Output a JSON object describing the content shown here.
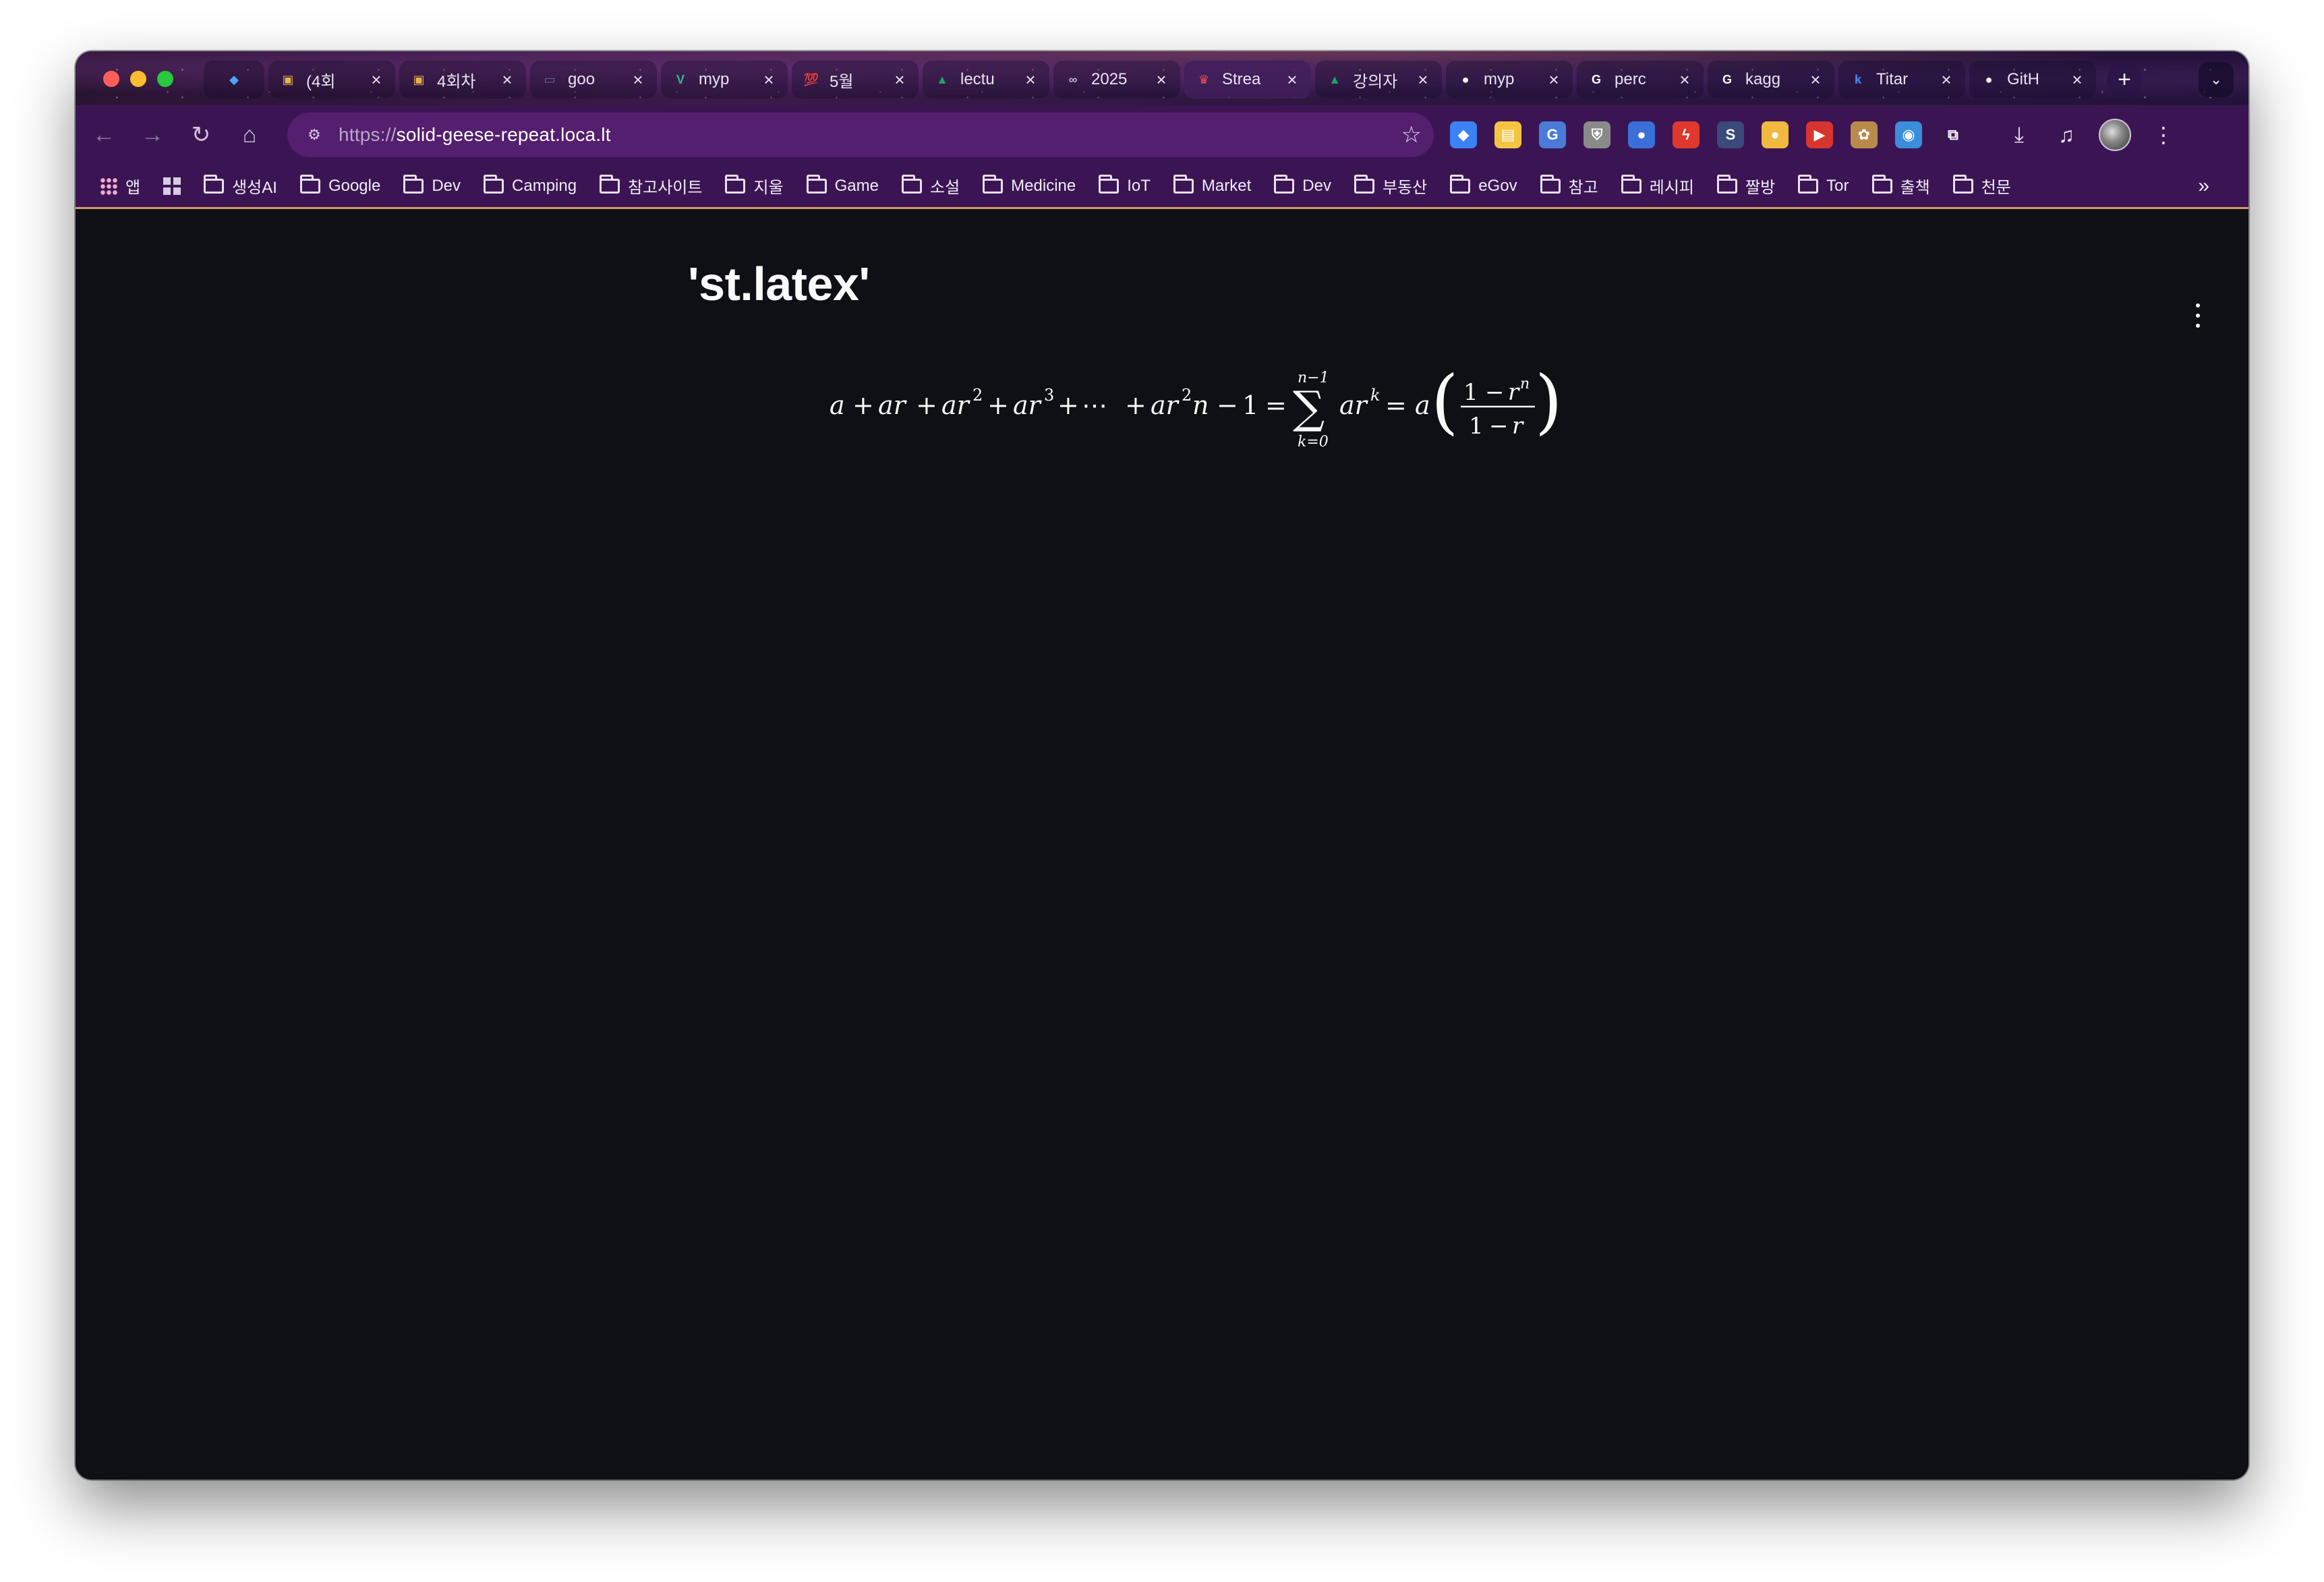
{
  "window": {
    "tabs": [
      {
        "title": "",
        "favicon": "gem-icon",
        "color": "#4aa3ff",
        "pinned": true
      },
      {
        "title": "(4회",
        "favicon": "package-icon",
        "color": "#e6b24a"
      },
      {
        "title": "4회차",
        "favicon": "package-icon",
        "color": "#e6b24a"
      },
      {
        "title": "goo",
        "favicon": "monitor-icon",
        "color": "#5a6b8c"
      },
      {
        "title": "myp",
        "favicon": "v-icon",
        "color": "#3fb27f"
      },
      {
        "title": "5월",
        "favicon": "hundred-icon",
        "color": "#e0334a"
      },
      {
        "title": "lectu",
        "favicon": "drive-icon",
        "color": "#1fa463"
      },
      {
        "title": "2025",
        "favicon": "infinity-icon",
        "color": "#b8b8c8"
      },
      {
        "title": "Strea",
        "favicon": "crown-icon",
        "color": "#ff4b4b",
        "active": true
      },
      {
        "title": "강의자",
        "favicon": "drive-icon",
        "color": "#1fa463"
      },
      {
        "title": "myp",
        "favicon": "github-icon",
        "color": "#ffffff"
      },
      {
        "title": "perc",
        "favicon": "google-icon",
        "color": "#ffffff"
      },
      {
        "title": "kagg",
        "favicon": "google-icon",
        "color": "#ffffff"
      },
      {
        "title": "Titar",
        "favicon": "k-icon",
        "color": "#4a8cff"
      },
      {
        "title": "GitH",
        "favicon": "github-icon",
        "color": "#ffffff"
      }
    ],
    "new_tab_label": "+",
    "tab_search_label": "⌄"
  },
  "toolbar": {
    "url_scheme": "https://",
    "url_host": "solid-geese-repeat.loca.lt",
    "extensions": [
      {
        "name": "gem-ext-icon",
        "color": "#3b82f6",
        "glyph": "◆"
      },
      {
        "name": "note-ext-icon",
        "color": "#f5c542",
        "glyph": "▤"
      },
      {
        "name": "translate-ext-icon",
        "color": "#4a7bd8",
        "glyph": "G"
      },
      {
        "name": "shield-ext-icon",
        "color": "#8a8a8a",
        "glyph": "⛨"
      },
      {
        "name": "location-ext-icon",
        "color": "#3b6fd8",
        "glyph": "●"
      },
      {
        "name": "bolt-ext-icon",
        "color": "#e0382e",
        "glyph": "ϟ"
      },
      {
        "name": "s-ext-icon",
        "color": "#3a4a7a",
        "glyph": "S"
      },
      {
        "name": "circle-ext-icon",
        "color": "#f1b940",
        "glyph": "●"
      },
      {
        "name": "play-ext-icon",
        "color": "#d6362f",
        "glyph": "▶"
      },
      {
        "name": "cookie-ext-icon",
        "color": "#b88a4c",
        "glyph": "✿"
      },
      {
        "name": "colorwheel-ext-icon",
        "color": "#3a8edb",
        "glyph": "◉"
      },
      {
        "name": "puzzle-ext-icon",
        "color": "transparent",
        "glyph": "⧉"
      }
    ]
  },
  "bookmarks": {
    "apps_label": "앱",
    "items": [
      "생성AI",
      "Google",
      "Dev",
      "Camping",
      "참고사이트",
      "지울",
      "Game",
      "소설",
      "Medicine",
      "IoT",
      "Market",
      "Dev",
      "부동산",
      "eGov",
      "참고",
      "레시피",
      "짤방",
      "Tor",
      "출책",
      "천문"
    ],
    "overflow_label": "»"
  },
  "page": {
    "title": "'st.latex'",
    "latex": {
      "a": "a",
      "ar": "ar",
      "plus": "+",
      "minus": "−",
      "equals": "=",
      "sup2": "2",
      "sup3": "3",
      "cdots": "⋯",
      "n": "n",
      "one": "1",
      "sum": "∑",
      "sum_upper": "n−1",
      "sum_lower": "k=0",
      "supk": "k",
      "r": "r",
      "supn": "n",
      "lparen": "(",
      "rparen": ")"
    }
  }
}
